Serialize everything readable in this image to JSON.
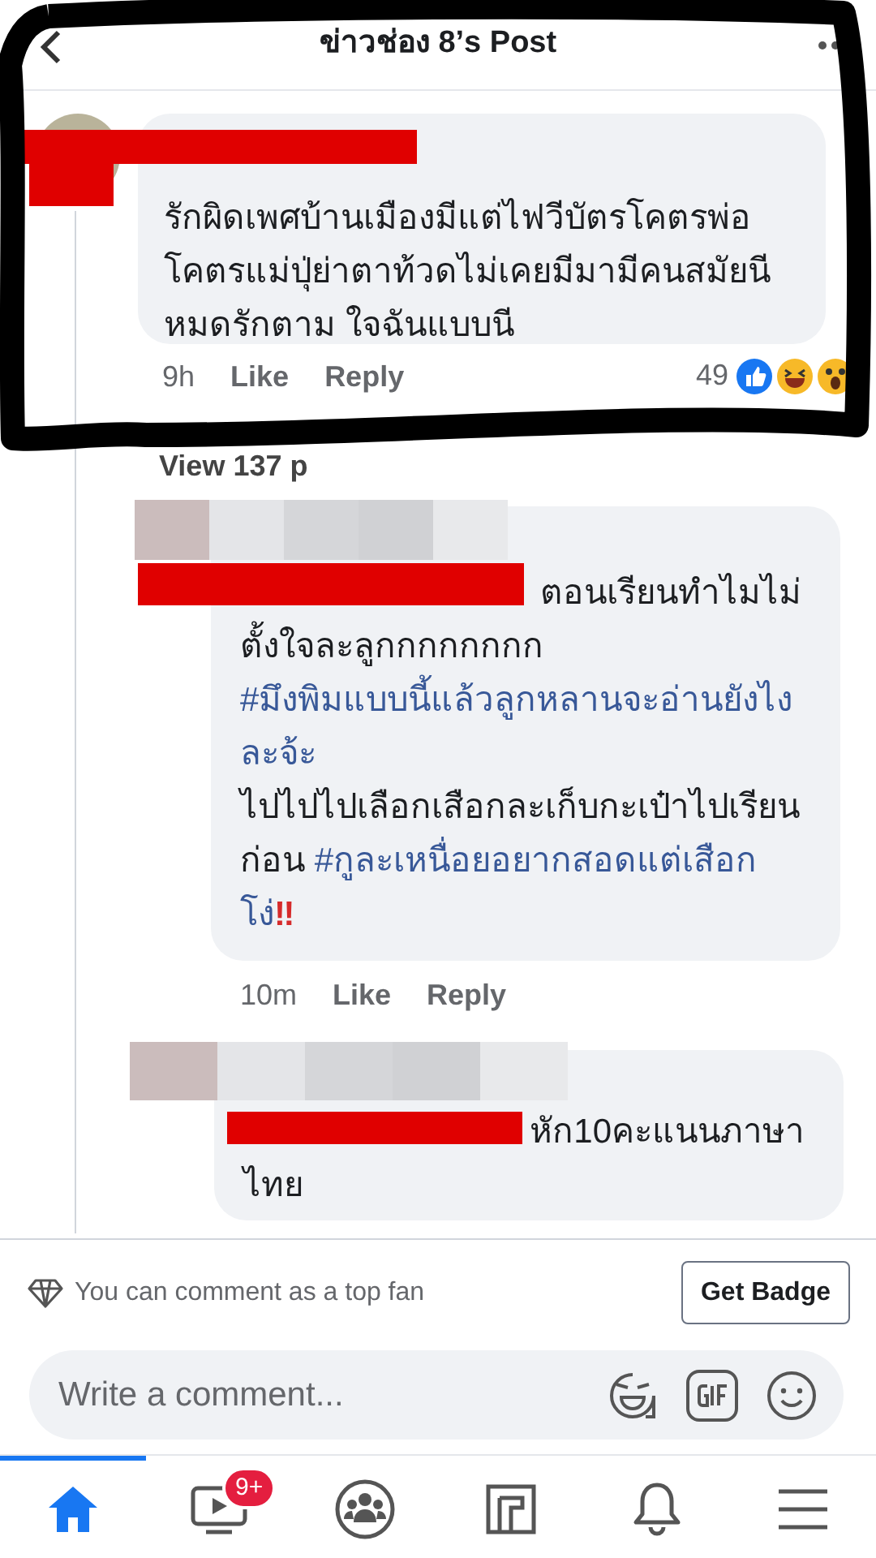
{
  "header": {
    "title": "ข่าวช่อง 8’s Post"
  },
  "comment": {
    "text": "รักผิดเพศบ้านเมืองมีแต่ไฟวีบัตรโคตรพ่อโคตรแม่ปุ่ย่าตาท้วดไม่เคยมีมามีคนสมัยนี หมดรักตาม ใจฉันแบบนี",
    "time": "9h",
    "like": "Like",
    "reply": "Reply",
    "reaction_count": "49"
  },
  "view_replies": "View 137 p",
  "replies": [
    {
      "lead": "ตอนเรียนทำไมไม่",
      "segments": [
        {
          "kind": "text",
          "text": "ตั้งใจละลูกกกกกกกก\n"
        },
        {
          "kind": "hashtag",
          "text": "#มึงพิมแบบนี้แล้วลูกหลานจะอ่านยังไงละจ้ะ"
        },
        {
          "kind": "text",
          "text": "\nไปไปไปเลือกเสือกละเก็บกะเป๋าไปเรียนก่อน "
        },
        {
          "kind": "hashtag",
          "text": "#กูละเหนื่อยอยากสอดแต่เสือกโง่"
        },
        {
          "kind": "emoji",
          "text": "‼"
        }
      ],
      "time": "10m",
      "like": "Like",
      "reply": "Reply"
    },
    {
      "lead": "หัก10คะแนนภาษา",
      "segments": [
        {
          "kind": "text",
          "text": "ไทย"
        }
      ]
    }
  ],
  "top_fan": {
    "text": "You can comment as a top fan",
    "button": "Get Badge"
  },
  "composer": {
    "placeholder": "Write a comment..."
  },
  "nav": [
    {
      "kind": "home",
      "selected": true
    },
    {
      "kind": "watch",
      "selected": false,
      "badge": "9+"
    },
    {
      "kind": "groups",
      "selected": false
    },
    {
      "kind": "gaming",
      "selected": false
    },
    {
      "kind": "bell",
      "selected": false
    },
    {
      "kind": "menu",
      "selected": false
    }
  ]
}
